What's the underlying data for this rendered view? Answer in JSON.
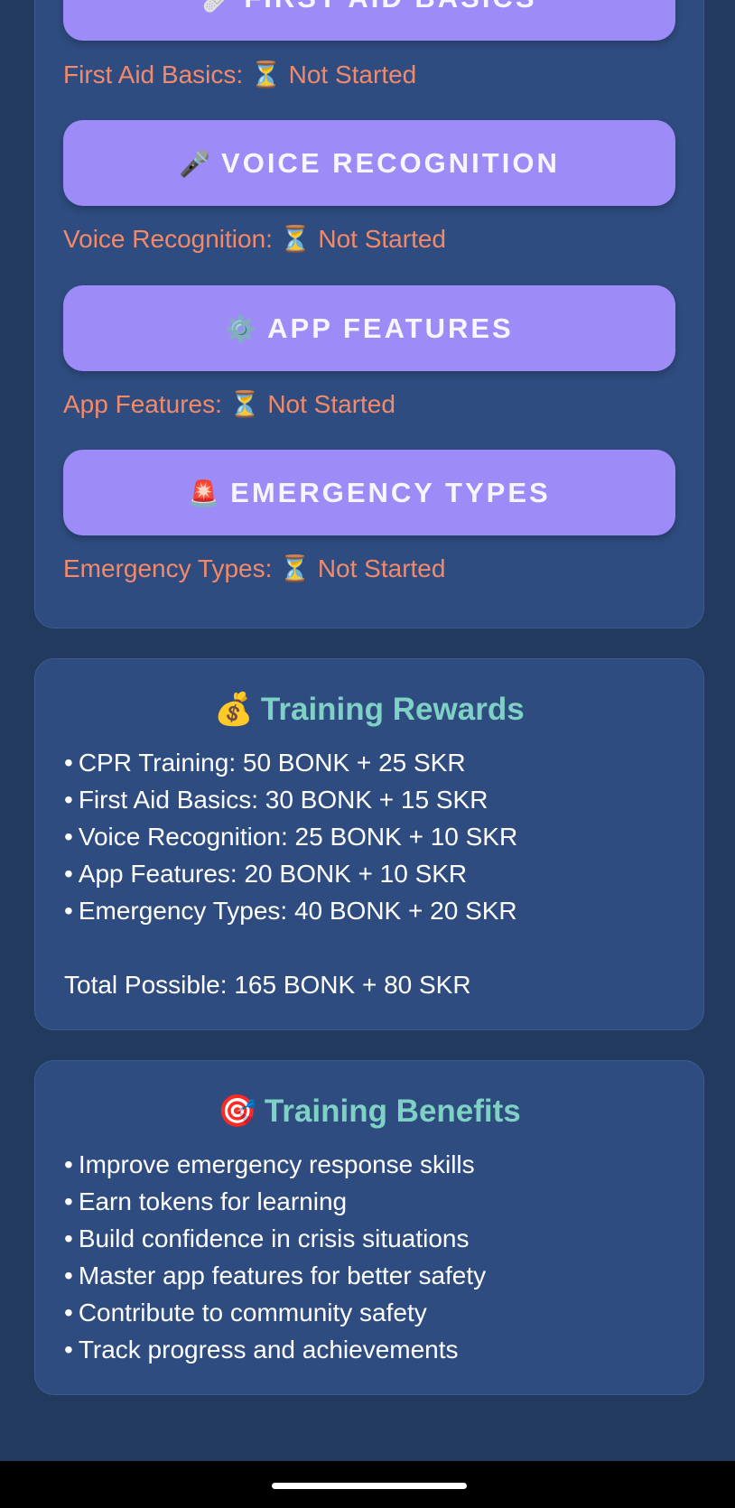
{
  "training": {
    "modules": [
      {
        "icon": "🩹",
        "icon_name": "bandage-icon",
        "button_label": "First Aid Basics",
        "status_text": "First Aid Basics:",
        "status_icon": "⏳",
        "status_value": "Not Started"
      },
      {
        "icon": "🎤",
        "icon_name": "microphone-icon",
        "button_label": "Voice Recognition",
        "status_text": "Voice Recognition:",
        "status_icon": "⏳",
        "status_value": "Not Started"
      },
      {
        "icon": "⚙️",
        "icon_name": "gear-icon",
        "button_label": "App Features",
        "status_text": "App Features:",
        "status_icon": "⏳",
        "status_value": "Not Started"
      },
      {
        "icon": "🚨",
        "icon_name": "siren-icon",
        "button_label": "Emergency Types",
        "status_text": "Emergency Types:",
        "status_icon": "⏳",
        "status_value": "Not Started"
      }
    ]
  },
  "rewards": {
    "icon": "💰",
    "icon_name": "money-bag-icon",
    "title": "Training Rewards",
    "bullet": "•",
    "items": [
      "CPR Training: 50 BONK + 25 SKR",
      "First Aid Basics: 30 BONK + 15 SKR",
      "Voice Recognition: 25 BONK + 10 SKR",
      "App Features: 20 BONK + 10 SKR",
      "Emergency Types: 40 BONK + 20 SKR"
    ],
    "total": "Total Possible: 165 BONK + 80 SKR"
  },
  "benefits": {
    "icon": "🎯",
    "icon_name": "target-icon",
    "title": "Training Benefits",
    "bullet": "•",
    "items": [
      "Improve emergency response skills",
      "Earn tokens for learning",
      "Build confidence in crisis situations",
      "Master app features for better safety",
      "Contribute to community safety",
      "Track progress and achievements"
    ]
  },
  "colors": {
    "background": "#213a5e",
    "card": "#2f4c80",
    "button": "#9d8cf7",
    "status": "#f28a6a",
    "heading": "#7fd1c5"
  }
}
